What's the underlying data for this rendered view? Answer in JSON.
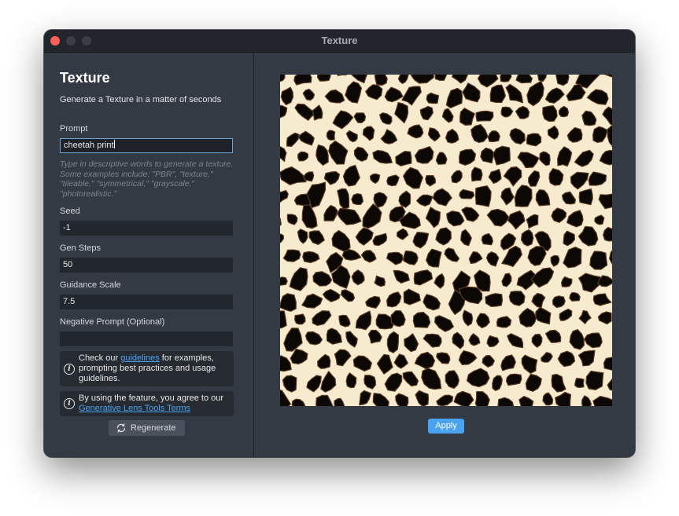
{
  "window": {
    "title": "Texture"
  },
  "panel": {
    "heading": "Texture",
    "subtitle": "Generate a Texture in a matter of seconds",
    "prompt": {
      "label": "Prompt",
      "value": "cheetah print",
      "hint": "Type in descriptive words to generate a texture. Some examples include: \"PBR\", \"texture,\" \"tileable,\" \"symmetrical,\" \"grayscale,\" \"photorealistic.\""
    },
    "seed": {
      "label": "Seed",
      "value": "-1"
    },
    "gen_steps": {
      "label": "Gen Steps",
      "value": "50"
    },
    "guidance_scale": {
      "label": "Guidance Scale",
      "value": "7.5"
    },
    "negative_prompt": {
      "label": "Negative Prompt (Optional)",
      "value": ""
    },
    "guidelines_info": {
      "pre": "Check our ",
      "link": "guidelines",
      "post": " for examples, prompting best practices and usage guidelines."
    },
    "terms_info": {
      "pre": "By using the feature, you agree to our ",
      "link": "Generative Lens Tools Terms"
    },
    "regenerate_label": "Regenerate"
  },
  "preview": {
    "apply_label": "Apply",
    "image_name": "cheetah-print-texture"
  },
  "colors": {
    "accent": "#4aa3f0",
    "close": "#fe5f57",
    "panel": "#343a44"
  },
  "icons": {
    "info": "info-circle-icon",
    "regenerate": "refresh-icon"
  }
}
